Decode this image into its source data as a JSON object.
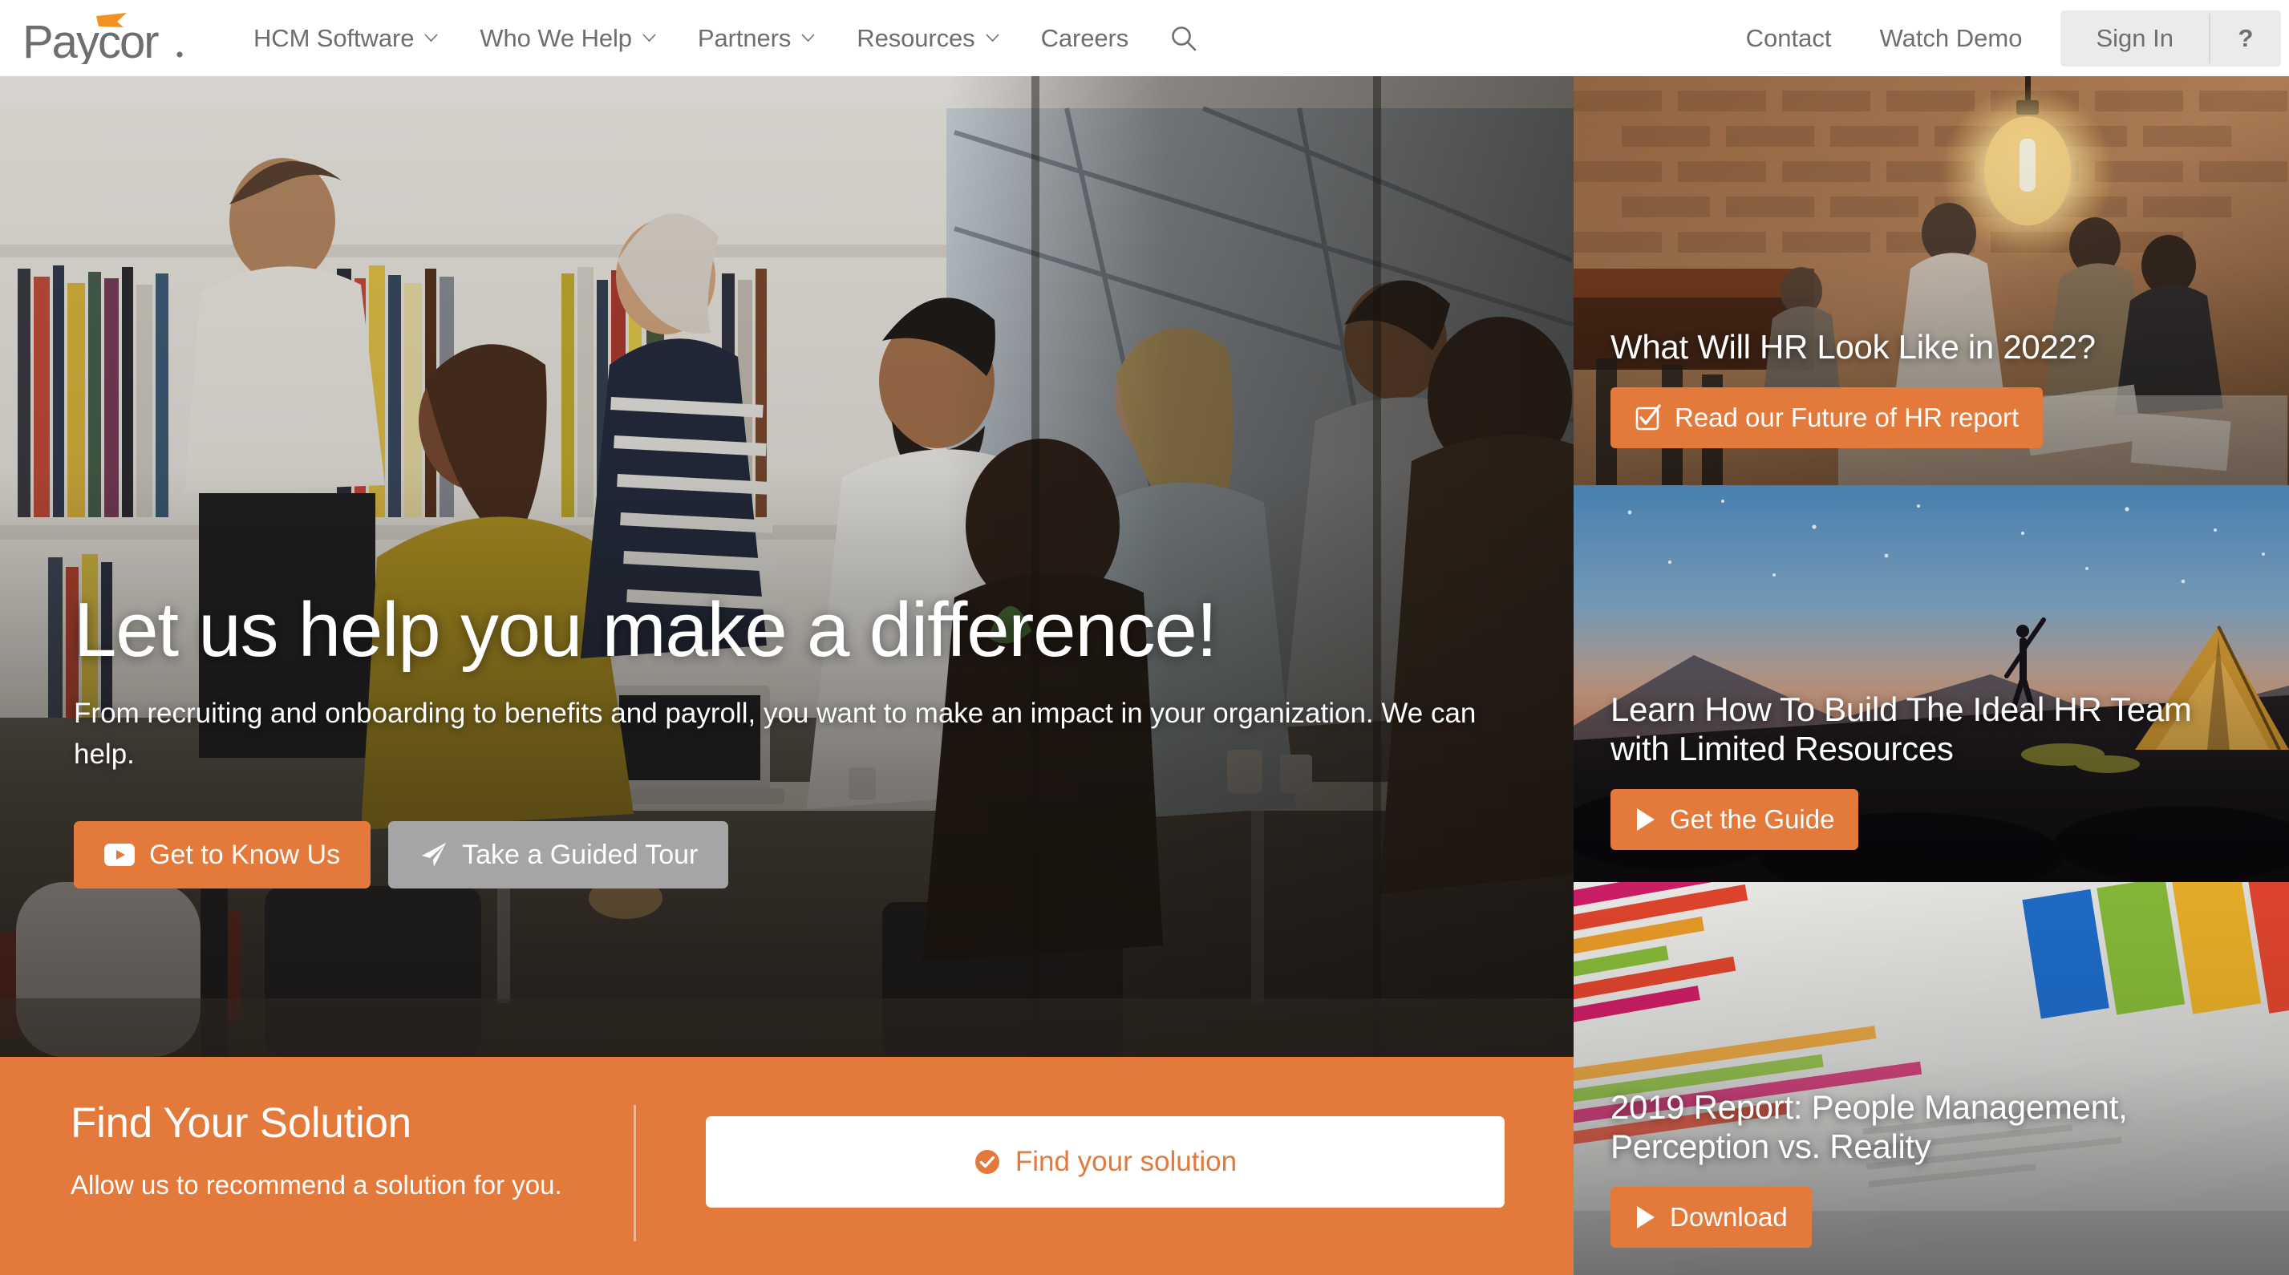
{
  "brand": {
    "name": "Paycor",
    "logo_wordmark": "Paycor",
    "accent_color": "#E3793A",
    "text_gray": "#6D6E70"
  },
  "header": {
    "nav": [
      {
        "label": "HCM Software",
        "icon": "chevron-down-icon",
        "has_dropdown": true
      },
      {
        "label": "Who We Help",
        "icon": "chevron-down-icon",
        "has_dropdown": true
      },
      {
        "label": "Partners",
        "icon": "chevron-down-icon",
        "has_dropdown": true
      },
      {
        "label": "Resources",
        "icon": "chevron-down-icon",
        "has_dropdown": true
      },
      {
        "label": "Careers",
        "icon": "",
        "has_dropdown": false
      }
    ],
    "search_icon": "search-icon",
    "right_links": [
      {
        "label": "Contact"
      },
      {
        "label": "Watch Demo"
      }
    ],
    "sign_in_label": "Sign In",
    "help_label": "?"
  },
  "hero": {
    "title": "Let us help you make a difference!",
    "subtitle": "From recruiting and onboarding to benefits and payroll, you want to make an impact in your organization. We can help.",
    "buttons": [
      {
        "label": "Get to Know Us",
        "icon": "youtube-play-icon",
        "style": "orange"
      },
      {
        "label": "Take a Guided Tour",
        "icon": "paper-plane-icon",
        "style": "gray"
      }
    ],
    "image_alt": "Diverse team collaborating around a table in a modern office with bookshelves"
  },
  "find_your_solution": {
    "title": "Find Your Solution",
    "subtitle": "Allow us to recommend a solution for you.",
    "button": {
      "label": "Find your solution",
      "icon": "check-circle-icon"
    }
  },
  "promo_cards": [
    {
      "title": "What Will HR Look Like in 2022?",
      "button": {
        "label": "Read our Future of HR report",
        "icon": "checked-box-icon"
      },
      "image_alt": "People meeting at a wooden table under a glowing edison bulb against a brick wall"
    },
    {
      "title": "Learn How To Build The Ideal HR Team with Limited Resources",
      "button": {
        "label": "Get the Guide",
        "icon": "play-triangle-icon"
      },
      "image_alt": "Camper silhouetted beside a lit tent under a twilight sky"
    },
    {
      "title": "2019 Report: People Management, Perception vs. Reality",
      "button": {
        "label": "Download",
        "icon": "play-triangle-icon"
      },
      "image_alt": "Colorful printed bar chart reports spread on a desk"
    }
  ]
}
